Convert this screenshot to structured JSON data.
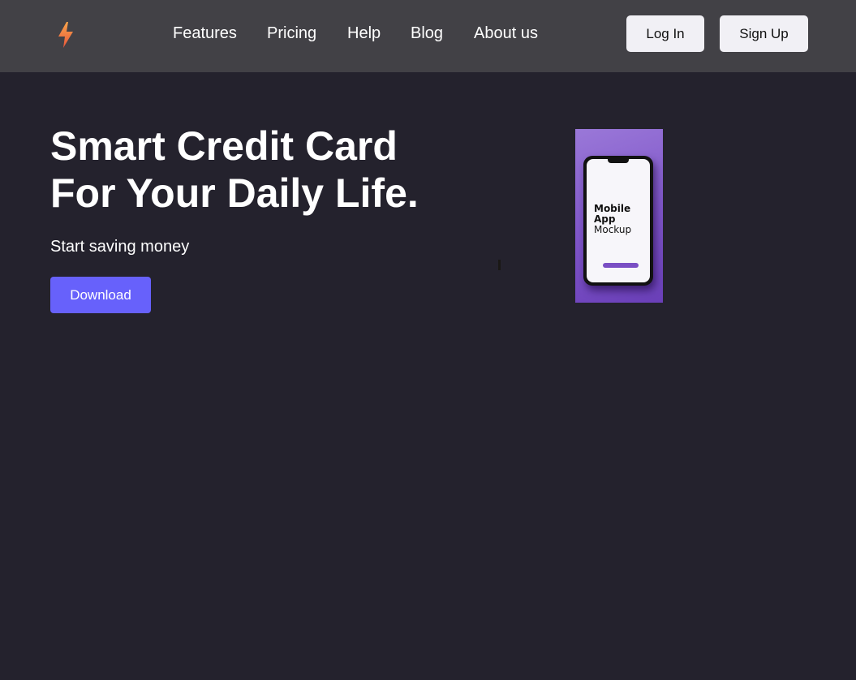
{
  "navbar": {
    "logo_icon": "lightning-bolt-icon",
    "logo_colors": [
      "#f7a44a",
      "#e8573c"
    ],
    "links": [
      "Features",
      "Pricing",
      "Help",
      "Blog",
      "About us"
    ],
    "login_label": "Log In",
    "signup_label": "Sign Up"
  },
  "hero": {
    "title_line1": "Smart Credit Card",
    "title_line2": "For Your Daily Life.",
    "subtitle": "Start saving money",
    "download_label": "Download"
  },
  "mockup": {
    "title_bold_1": "Mobile",
    "title_bold_2": "App",
    "title_light": "Mockup"
  },
  "colors": {
    "background": "#24222d",
    "navbar": "#424146",
    "accent": "#6761fb",
    "button_light": "#f1f0f5",
    "mockup_purple": "#8a62cf"
  }
}
